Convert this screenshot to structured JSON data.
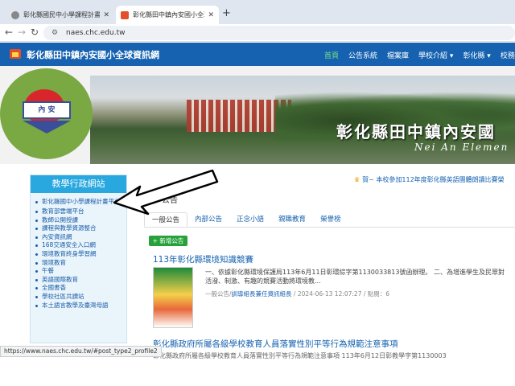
{
  "browser": {
    "tabs": [
      {
        "title": "彰化縣國民中小學課程計畫平台",
        "active": false
      },
      {
        "title": "彰化縣田中鎮內安國小全球資訊網",
        "active": true
      }
    ],
    "new_tab": "+",
    "url": "naes.chc.edu.tw",
    "status_url": "https://www.naes.chc.edu.tw/#post_type2_profile2"
  },
  "site": {
    "title": "彰化縣田中鎮內安國小全球資訊網",
    "nav": [
      "首頁",
      "公告系統",
      "檔案庫",
      "學校介紹 ▾",
      "彰化縣 ▾",
      "校務行政"
    ],
    "banner_cn": "彰化縣田中鎮內安國",
    "banner_en": "Nei An Elemen",
    "emblem_text": "內  安"
  },
  "sidebar": {
    "title": "教學行政網站",
    "items": [
      "彰化縣國中小學課程計畫平台",
      "教育部雲端平台",
      "教師公開授課",
      "課程與教學資源整合",
      "內安資訊網",
      "168交通安全入口網",
      "環境教育終身學習網",
      "環境教育",
      "午餐",
      "英語國際教育",
      "全國書香",
      "學校社區共讀站",
      "本土語言教學及臺灣母語"
    ]
  },
  "marquee": "賀~ 本校參加112年度彰化縣英語團體朗讀比賽榮",
  "announce": {
    "title": "公告",
    "tabs": [
      "一般公告",
      "內部公告",
      "正念小語",
      "親職教育",
      "榮譽榜"
    ],
    "add_button": "+ 新增公告",
    "posts": [
      {
        "title": "113年彰化縣環境知識競賽",
        "body_line1": "一、依據彰化縣環境保護局113年6月11日彰環綜字第1130033813號函辦理。 二、為增進學生及民眾對",
        "body_line2": "活潑、制激、有趣的競賽活動將環境教...",
        "meta_prefix": "一般公告/",
        "dept": "訓導組長兼任資訊組長",
        "meta_suffix": " / 2024-06-13 12:07:27 / 點閱：6"
      },
      {
        "title": "彰化縣政府所屬各級學校教育人員落實性別平等行為規範注意事項",
        "body_line1": "彰化縣政府所屬各級學校教育人員落實性別平等行為規範注意事項 113年6月12日彰教學字第1130003"
      }
    ]
  },
  "colors": {
    "header_blue": "#1662b0",
    "sidebar_head": "#29a7df",
    "add_green": "#27a13a",
    "nav_active": "#7ee37e"
  }
}
